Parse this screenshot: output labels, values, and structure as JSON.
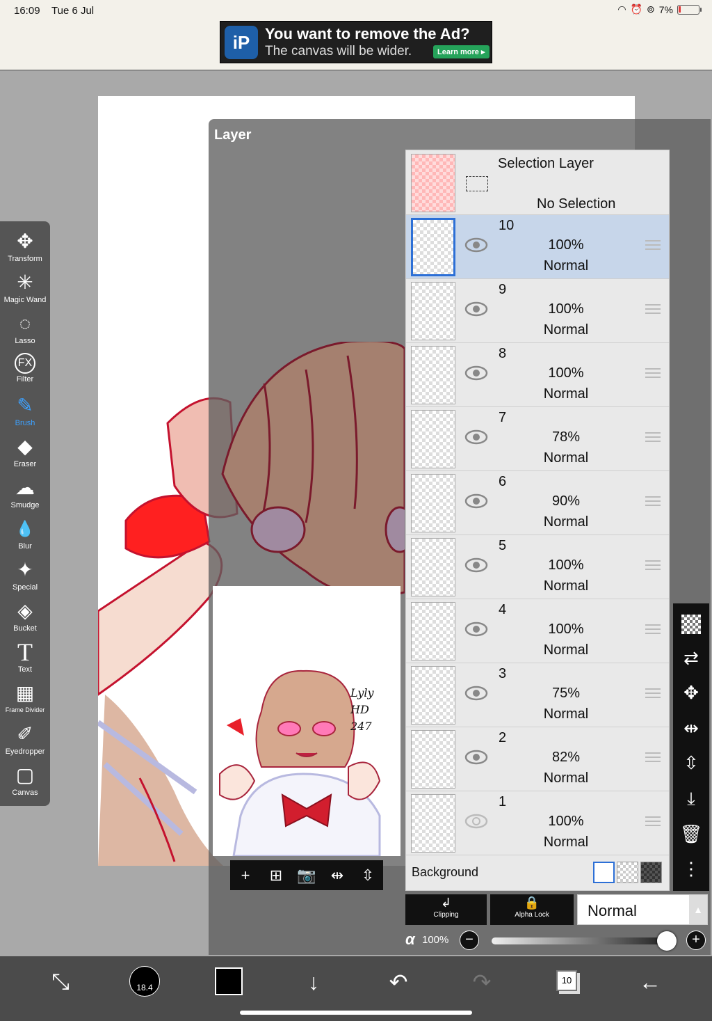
{
  "status": {
    "time": "16:09",
    "date": "Tue 6 Jul",
    "battery": "7%"
  },
  "ad": {
    "title": "You want to remove the Ad?",
    "subtitle": "The canvas will be wider.",
    "cta": "Learn more ▸",
    "logo": "iP"
  },
  "toolbar": {
    "items": [
      {
        "label": "Transform",
        "icon": "✥"
      },
      {
        "label": "Magic Wand",
        "icon": "✳"
      },
      {
        "label": "Lasso",
        "icon": "◌"
      },
      {
        "label": "Filter",
        "icon": "FX"
      },
      {
        "label": "Brush",
        "icon": "✎"
      },
      {
        "label": "Eraser",
        "icon": "◆"
      },
      {
        "label": "Smudge",
        "icon": "☁"
      },
      {
        "label": "Blur",
        "icon": "💧"
      },
      {
        "label": "Special",
        "icon": "✦"
      },
      {
        "label": "Bucket",
        "icon": "◈"
      },
      {
        "label": "Text",
        "icon": "T"
      },
      {
        "label": "Frame Divider",
        "icon": "▦"
      },
      {
        "label": "Eyedropper",
        "icon": "✐"
      },
      {
        "label": "Canvas",
        "icon": "▢"
      }
    ],
    "active": "Brush"
  },
  "panel": {
    "title": "Layer"
  },
  "preview": {
    "signature": "Lyly HD 247"
  },
  "selection_layer": {
    "name": "Selection Layer",
    "status": "No Selection"
  },
  "layers": [
    {
      "num": "10",
      "opacity": "100%",
      "mode": "Normal",
      "visible": true,
      "selected": true
    },
    {
      "num": "9",
      "opacity": "100%",
      "mode": "Normal",
      "visible": true,
      "selected": false
    },
    {
      "num": "8",
      "opacity": "100%",
      "mode": "Normal",
      "visible": true,
      "selected": false
    },
    {
      "num": "7",
      "opacity": "78%",
      "mode": "Normal",
      "visible": true,
      "selected": false
    },
    {
      "num": "6",
      "opacity": "90%",
      "mode": "Normal",
      "visible": true,
      "selected": false
    },
    {
      "num": "5",
      "opacity": "100%",
      "mode": "Normal",
      "visible": true,
      "selected": false
    },
    {
      "num": "4",
      "opacity": "100%",
      "mode": "Normal",
      "visible": true,
      "selected": false
    },
    {
      "num": "3",
      "opacity": "75%",
      "mode": "Normal",
      "visible": true,
      "selected": false
    },
    {
      "num": "2",
      "opacity": "82%",
      "mode": "Normal",
      "visible": true,
      "selected": false
    },
    {
      "num": "1",
      "opacity": "100%",
      "mode": "Normal",
      "visible": false,
      "selected": false
    }
  ],
  "background": {
    "label": "Background"
  },
  "blend": {
    "clipping": "Clipping",
    "alpha_lock": "Alpha Lock",
    "mode": "Normal"
  },
  "alpha": {
    "symbol": "α",
    "value": "100%",
    "level": 1.0
  },
  "bottom": {
    "brush_size": "18.4",
    "layer_count": "10"
  },
  "colors": {
    "accent": "#2c6fd6",
    "brush_active": "#3da1ff",
    "primary_color": "#000000"
  }
}
